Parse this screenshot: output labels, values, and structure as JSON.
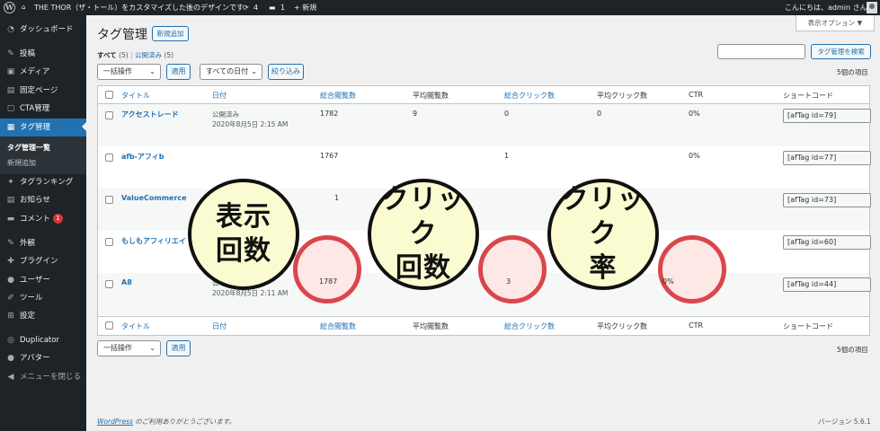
{
  "adminbar": {
    "site_title": "THE THOR（ザ・トール）をカスタマイズした後のデザインです",
    "updates": "4",
    "comments": "1",
    "new": "+ 新規",
    "greeting": "こんにちは、admin さん"
  },
  "sidebar": {
    "items": [
      {
        "icon": "dashboard-icon",
        "glyph": "◔",
        "label": "ダッシュボード"
      },
      {
        "icon": "pin-icon",
        "glyph": "✎",
        "label": "投稿"
      },
      {
        "icon": "media-icon",
        "glyph": "▣",
        "label": "メディア"
      },
      {
        "icon": "page-icon",
        "glyph": "▤",
        "label": "固定ページ"
      },
      {
        "icon": "cta-icon",
        "glyph": "▢",
        "label": "CTA管理"
      },
      {
        "icon": "tag-icon",
        "glyph": "▦",
        "label": "タグ管理"
      },
      {
        "icon": "ranking-icon",
        "glyph": "✦",
        "label": "タグランキング"
      },
      {
        "icon": "notice-icon",
        "glyph": "▤",
        "label": "お知らせ"
      },
      {
        "icon": "comment-icon",
        "glyph": "▬",
        "label": "コメント"
      },
      {
        "icon": "appearance-icon",
        "glyph": "✎",
        "label": "外観"
      },
      {
        "icon": "plugin-icon",
        "glyph": "✚",
        "label": "プラグイン"
      },
      {
        "icon": "user-icon",
        "glyph": "●",
        "label": "ユーザー"
      },
      {
        "icon": "tool-icon",
        "glyph": "✐",
        "label": "ツール"
      },
      {
        "icon": "settings-icon",
        "glyph": "⊞",
        "label": "設定"
      },
      {
        "icon": "duplicator-icon",
        "glyph": "◎",
        "label": "Duplicator"
      },
      {
        "icon": "avatar-icon",
        "glyph": "●",
        "label": "アバター"
      },
      {
        "icon": "collapse-icon",
        "glyph": "◀",
        "label": "メニューを閉じる"
      }
    ],
    "comment_badge": "1",
    "submenu": [
      "タグ管理一覧",
      "新規追加"
    ]
  },
  "page": {
    "title": "タグ管理",
    "add_new": "新規追加",
    "screen_options": "表示オプション ▼",
    "filter_all": "すべて",
    "filter_all_count": "(5)",
    "filter_sep": "|",
    "filter_published": "公開済み",
    "filter_published_count": "(5)",
    "search_placeholder": "",
    "search_button": "タグ管理を検索",
    "bulk_action": "一括操作",
    "apply": "適用",
    "all_dates": "すべての日付",
    "filter_button": "絞り込み",
    "item_count": "5個の項目"
  },
  "table": {
    "headers": [
      "タイトル",
      "日付",
      "総合閲覧数",
      "平均閲覧数",
      "総合クリック数",
      "平均クリック数",
      "CTR",
      "ショートコード"
    ],
    "rows": [
      {
        "title": "アクセストレード",
        "date_status": "公開済み",
        "date": "2020年8月5日 2:15 AM",
        "views": "1782",
        "avg_views": "9",
        "clicks": "0",
        "avg_clicks": "0",
        "ctr": "0%",
        "shortcode": "[afTag id=79]"
      },
      {
        "title": "afb-アフィb",
        "date_status": "",
        "date": "",
        "views": "1767",
        "avg_views": "",
        "clicks": "1",
        "avg_clicks": "",
        "ctr": "0%",
        "shortcode": "[afTag id=77]"
      },
      {
        "title": "ValueCommerce",
        "date_status": "",
        "date": "",
        "views": "1",
        "avg_views": "",
        "clicks": "",
        "avg_clicks": "",
        "ctr": "",
        "shortcode": "[afTag id=73]"
      },
      {
        "title": "もしもアフィリエイ",
        "date_status": "",
        "date": "",
        "views": "",
        "avg_views": "",
        "clicks": "",
        "avg_clicks": "",
        "ctr": "0%",
        "shortcode": "[afTag id=60]"
      },
      {
        "title": "A8",
        "date_status": "公",
        "date": "2020年8月5日 2:11 AM",
        "views": "1787",
        "avg_views": "",
        "clicks": "3",
        "avg_clicks": "",
        "ctr": "0%",
        "shortcode": "[afTag id=44]"
      }
    ]
  },
  "overlays": {
    "bubble1_line1": "表示",
    "bubble1_line2": "回数",
    "bubble2_line1": "クリック",
    "bubble2_line2": "回数",
    "bubble3_line1": "クリック",
    "bubble3_line2": "率",
    "ring_color": "#d9464b",
    "bubble_color": "#fafbd0"
  },
  "footer": {
    "credit_link": "WordPress",
    "credit_text": " のご利用ありがとうございます。",
    "version": "バージョン 5.6.1"
  }
}
